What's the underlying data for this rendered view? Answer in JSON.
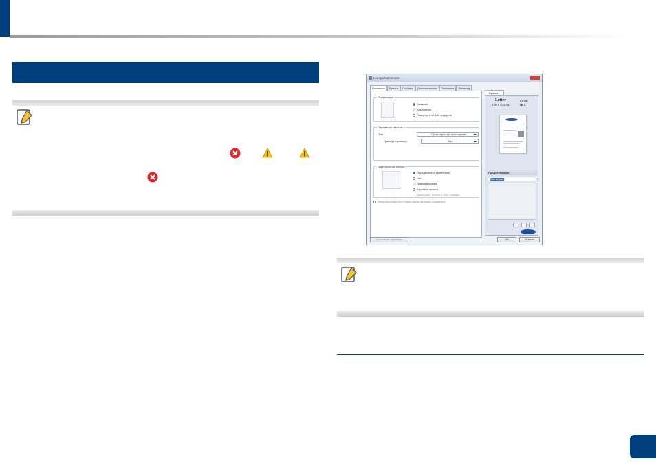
{
  "colors": {
    "brand_blue": "#003f7d",
    "note_gray": "#dedede",
    "error_red": "#d9252b",
    "warning_yellow": "#f5c400"
  },
  "icons": {
    "note": "note-pencil-icon",
    "error": "error-x-icon",
    "warning": "warning-triangle-icon"
  },
  "dialog": {
    "title": "Настройка печати",
    "tabs": [
      "Основные",
      "Бумага",
      "Графика",
      "Дополнительно",
      "Экономия",
      "Samsung"
    ],
    "orientation": {
      "title": "Ориентация",
      "options": [
        "Книжная",
        "Альбомная"
      ],
      "selected": "Книжная",
      "rotate_label": "Повернуть на 180 градусов"
    },
    "layout": {
      "title": "Параметры макета",
      "type_label": "Тип",
      "type_value": "Одна страница на стороне",
      "border_label": "Граница страницы",
      "border_value": "Нет"
    },
    "duplex": {
      "title": "Двусторонняя печать",
      "options": [
        "Определяется принтером",
        "Нет",
        "Длинная кромка",
        "Короткая кромка"
      ],
      "selected": "Определяется принтером",
      "reverse_label": "Двусторон. печать в обр. порядке"
    },
    "easy_eco_label": "Запустить Easy Eco Driver перед печатью документа",
    "preview": {
      "tab_label": "Бумага",
      "paper_name": "Letter",
      "paper_size": "8.50 x 11.00 д.",
      "unit_mm": "мм",
      "unit_in": "д.",
      "presets_label": "Предустановки",
      "preset_value": "Без имени"
    },
    "printer_status_button": "Состояние принтера",
    "ok_button": "ОК",
    "cancel_button": "Отмена"
  }
}
